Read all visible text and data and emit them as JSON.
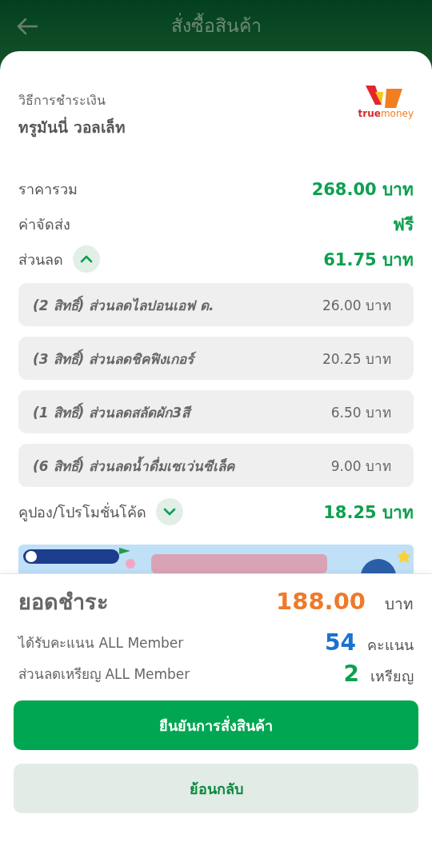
{
  "header": {
    "title": "สั่งซื้อสินค้า"
  },
  "payment": {
    "label": "วิธีการชำระเงิน",
    "method": "ทรูมันนี่ วอลเล็ท",
    "logo": {
      "strong": "true",
      "light": "money"
    }
  },
  "summary": [
    {
      "kind": "plain",
      "label": "ราคารวม",
      "value": "268.00 บาท"
    },
    {
      "kind": "plain",
      "label": "ค่าจัดส่ง",
      "value": "ฟรี"
    },
    {
      "kind": "toggle",
      "label": "ส่วนลด",
      "value": "61.75 บาท",
      "expanded": true,
      "items": [
        {
          "name": "(2 สิทธิ์) ส่วนลดไลปอนเอฟ ด.",
          "amount": "26.00 บาท"
        },
        {
          "name": "(3 สิทธิ์) ส่วนลดชิคฟิงเกอร์",
          "amount": "20.25 บาท"
        },
        {
          "name": "(1 สิทธิ์) ส่วนลดสลัดผัก3สี",
          "amount": "6.50 บาท"
        },
        {
          "name": "(6 สิทธิ์) ส่วนลดน้ำดื่มเซเว่นซีเล็ค",
          "amount": "9.00 บาท"
        }
      ]
    },
    {
      "kind": "toggle",
      "label": "คูปอง/โปรโมชั่นโค้ด",
      "value": "18.25 บาท",
      "expanded": false
    }
  ],
  "total": {
    "label": "ยอดชำระ",
    "amount": "188.00",
    "unit": "บาท"
  },
  "rewards": [
    {
      "label": "ได้รับคะแนน ALL Member",
      "value": "54",
      "unit": "คะแนน",
      "color": "#1a73d0"
    },
    {
      "label": "ส่วนลดเหรียญ ALL Member",
      "value": "2",
      "unit": "เหรียญ",
      "color": "#0ea04f"
    }
  ],
  "buttons": [
    {
      "kind": "primary",
      "label": "ยืนยันการสั่งสินค้า"
    },
    {
      "kind": "secondary",
      "label": "ย้อนกลับ"
    }
  ]
}
